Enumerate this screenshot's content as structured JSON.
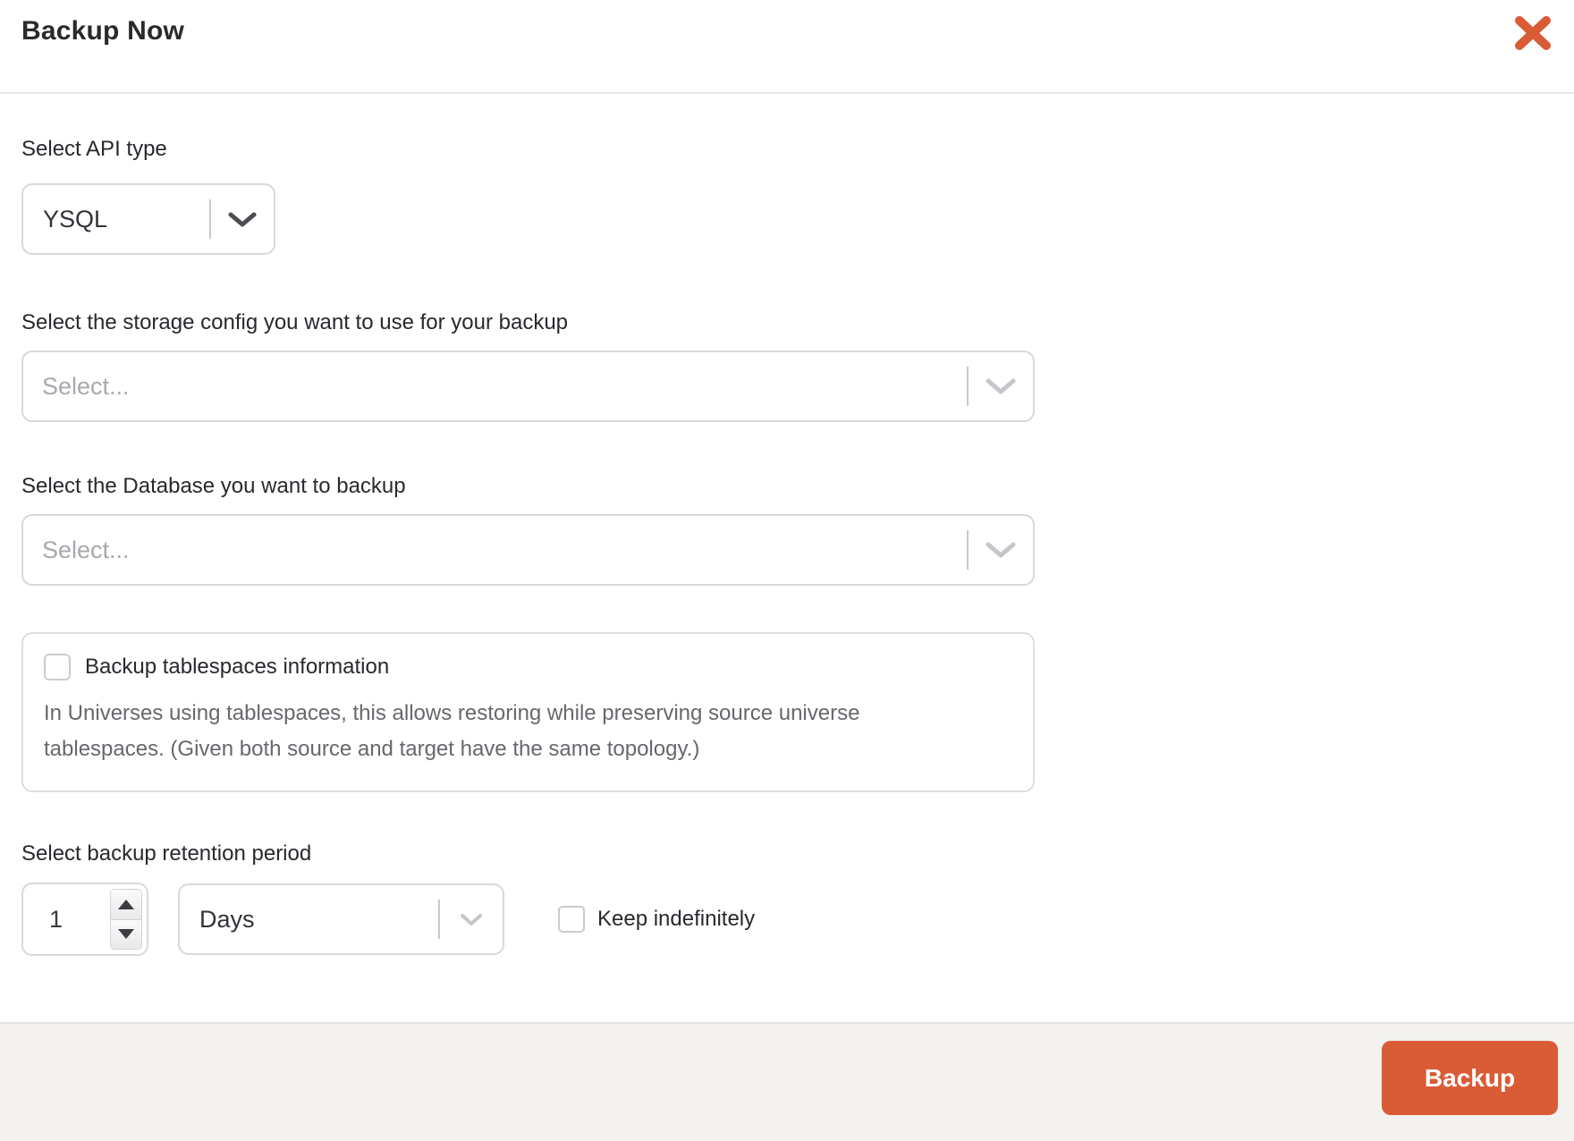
{
  "modal": {
    "title": "Backup Now"
  },
  "api_type": {
    "label": "Select API type",
    "value": "YSQL"
  },
  "storage_config": {
    "label": "Select the storage config you want to use for your backup",
    "placeholder": "Select..."
  },
  "database": {
    "label": "Select the Database you want to backup",
    "placeholder": "Select..."
  },
  "tablespaces": {
    "checkbox_label": "Backup tablespaces information",
    "checked": false,
    "description": "In Universes using tablespaces, this allows restoring while preserving source universe tablespaces. (Given both source and target have the same topology.)"
  },
  "retention": {
    "label": "Select backup retention period",
    "value": "1",
    "unit": "Days",
    "keep_label": "Keep indefinitely",
    "keep_checked": false
  },
  "footer": {
    "backup_label": "Backup"
  },
  "colors": {
    "accent_orange": "#d95c36",
    "footer_bg": "#f4f2ee",
    "border_gray": "#d8d7dc",
    "placeholder_gray": "#a9a8ae",
    "text_dark": "#29282e",
    "text_muted": "#68676d"
  }
}
